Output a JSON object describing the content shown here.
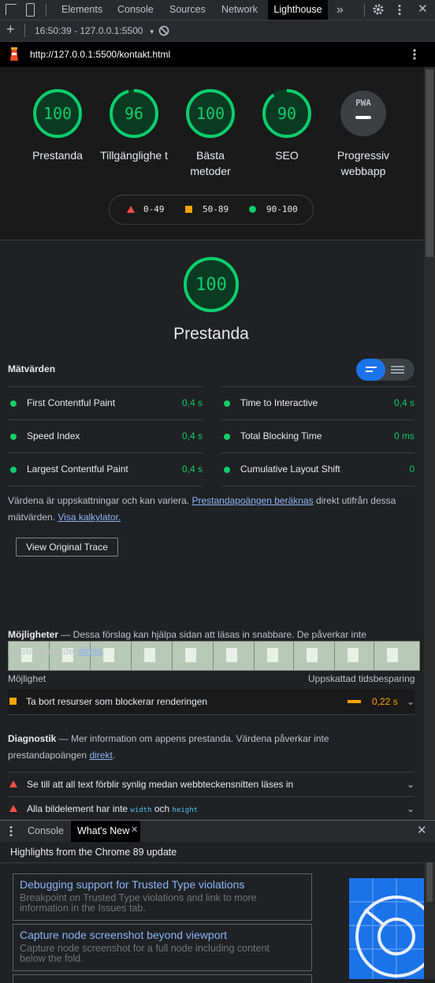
{
  "devtools": {
    "tabs": [
      "Elements",
      "Console",
      "Sources",
      "Network",
      "Lighthouse"
    ],
    "more_tabs_glyph": "»",
    "report_label": "16:50:39 - 127.0.0.1:5500",
    "url": "http://127.0.0.1:5500/kontakt.html"
  },
  "gauges": [
    {
      "score": "100",
      "label": "Prestanda",
      "color": "#0cce6b",
      "fraction": 1.0
    },
    {
      "score": "96",
      "label": "Tillgänglighe t",
      "color": "#0cce6b",
      "fraction": 0.96
    },
    {
      "score": "100",
      "label": "Bästa metoder",
      "color": "#0cce6b",
      "fraction": 1.0
    },
    {
      "score": "90",
      "label": "SEO",
      "color": "#0cce6b",
      "fraction": 0.9
    },
    {
      "score": "PWA",
      "label": "Progressiv webbapp",
      "color": "#5f6368",
      "fraction": 0
    }
  ],
  "legend": {
    "fail": "0-49",
    "average": "50-89",
    "pass": "90-100"
  },
  "performance": {
    "score": "100",
    "title": "Prestanda"
  },
  "metrics": {
    "heading": "Mätvärden",
    "left": [
      {
        "label": "First Contentful Paint",
        "value": "0,4 s"
      },
      {
        "label": "Speed Index",
        "value": "0,4 s"
      },
      {
        "label": "Largest Contentful Paint",
        "value": "0,4 s"
      }
    ],
    "right": [
      {
        "label": "Time to Interactive",
        "value": "0,4 s"
      },
      {
        "label": "Total Blocking Time",
        "value": "0 ms"
      },
      {
        "label": "Cumulative Layout Shift",
        "value": "0"
      }
    ],
    "note_1": "Värdena är uppskattningar och kan variera. ",
    "note_link_1": "Prestandapoängen beräknas",
    "note_2": " direkt utifrån dessa",
    "note_3": "mätvärden. ",
    "note_link_2": "Visa kalkylator."
  },
  "view_trace": "View Original Trace",
  "opportunities": {
    "heading": "Möjligheter",
    "desc_1": " — Dessa förslag kan hjälpa sidan att läsas in snabbare. De påverkar inte",
    "desc_2": "prestandavärdet ",
    "desc_link": "direkt",
    "col_left": "Möjlighet",
    "col_right": "Uppskattad tidsbesparing",
    "item": "Ta bort resurser som blockerar renderingen",
    "item_value": "0,22 s"
  },
  "diagnostics": {
    "heading": "Diagnostik",
    "desc_1": " — Mer information om appens prestanda. Värdena påverkar inte",
    "desc_2": "prestandapoängen ",
    "desc_link": "direkt",
    "item1": "Se till att all text förblir synlig medan webbteckensnitten läses in",
    "item2_a": "Alla bildelement har inte ",
    "item2_code1": "width",
    "item2_b": " och ",
    "item2_code2": "height"
  },
  "drawer": {
    "tabs": [
      "Console",
      "What's New"
    ],
    "highlights": "Highlights from the Chrome 89 update",
    "cards": [
      {
        "title": "Debugging support for Trusted Type violations",
        "desc": "Breakpoint on Trusted Type violations and link to more information in the Issues tab."
      },
      {
        "title": "Capture node screenshot beyond viewport",
        "desc": "Capture node screenshot for a full node including content below the fold."
      }
    ]
  },
  "colors": {
    "pass": "#0cce6b",
    "average": "#ffa400",
    "fail": "#ff4e42",
    "accent": "#8ab4f8"
  }
}
